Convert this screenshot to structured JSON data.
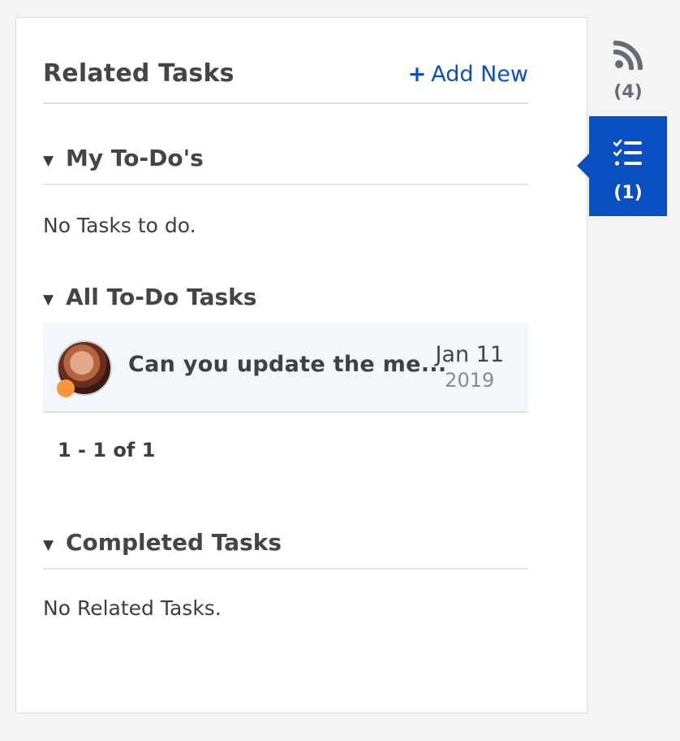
{
  "header": {
    "title": "Related Tasks",
    "add_new_plus": "+",
    "add_new_label": "Add New"
  },
  "sections": {
    "my_todos": {
      "caret": "▼",
      "label": "My To-Do's",
      "empty_text": "No Tasks to do."
    },
    "all_todos": {
      "caret": "▼",
      "label": "All To-Do Tasks"
    },
    "completed": {
      "caret": "▼",
      "label": "Completed Tasks",
      "empty_text": "No Related Tasks."
    }
  },
  "tasks": [
    {
      "title": "Can you update the me...",
      "date_day": "Jan 11",
      "date_year": "2019",
      "status_color": "#f7963a"
    }
  ],
  "pagination": {
    "text": "1 - 1 of 1"
  },
  "rail": {
    "feed": {
      "icon": "rss-feed-icon",
      "count": "(4)"
    },
    "tasks": {
      "icon": "task-list-icon",
      "count": "(1)"
    }
  },
  "colors": {
    "accent": "#0a4fc2",
    "status_dot": "#f7963a"
  }
}
